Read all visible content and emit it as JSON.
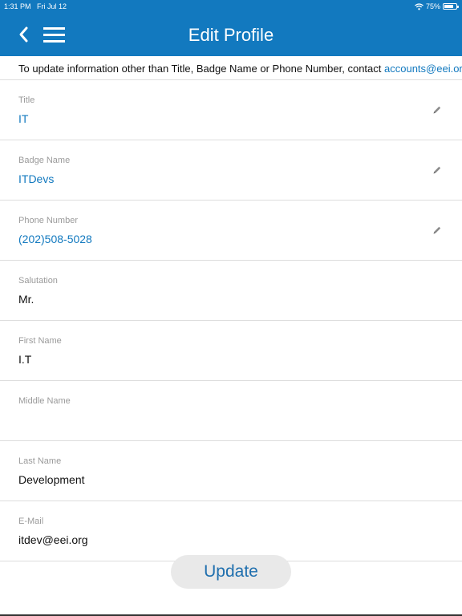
{
  "status_bar": {
    "time": "1:31 PM",
    "date": "Fri Jul 12",
    "battery_text": "75%",
    "battery_level": 0.75
  },
  "nav": {
    "title": "Edit Profile",
    "back_icon": "chevron-left-icon",
    "menu_icon": "hamburger-menu-icon"
  },
  "notice": {
    "text": "To update information other than Title, Badge Name or Phone Number, contact ",
    "email": "accounts@eei.org"
  },
  "fields": [
    {
      "label": "Title",
      "value": "IT",
      "editable": true
    },
    {
      "label": "Badge Name",
      "value": "ITDevs",
      "editable": true
    },
    {
      "label": "Phone Number",
      "value": "(202)508-5028",
      "editable": true
    },
    {
      "label": "Salutation",
      "value": "Mr.",
      "editable": false
    },
    {
      "label": "First Name",
      "value": "I.T",
      "editable": false
    },
    {
      "label": "Middle Name",
      "value": "",
      "editable": false
    },
    {
      "label": "Last Name",
      "value": "Development",
      "editable": false
    },
    {
      "label": "E-Mail",
      "value": "itdev@eei.org",
      "editable": false
    }
  ],
  "actions": {
    "update_label": "Update"
  },
  "colors": {
    "brand": "#1279bf",
    "editable_value": "#1279bf",
    "label": "#9a9a9a"
  }
}
